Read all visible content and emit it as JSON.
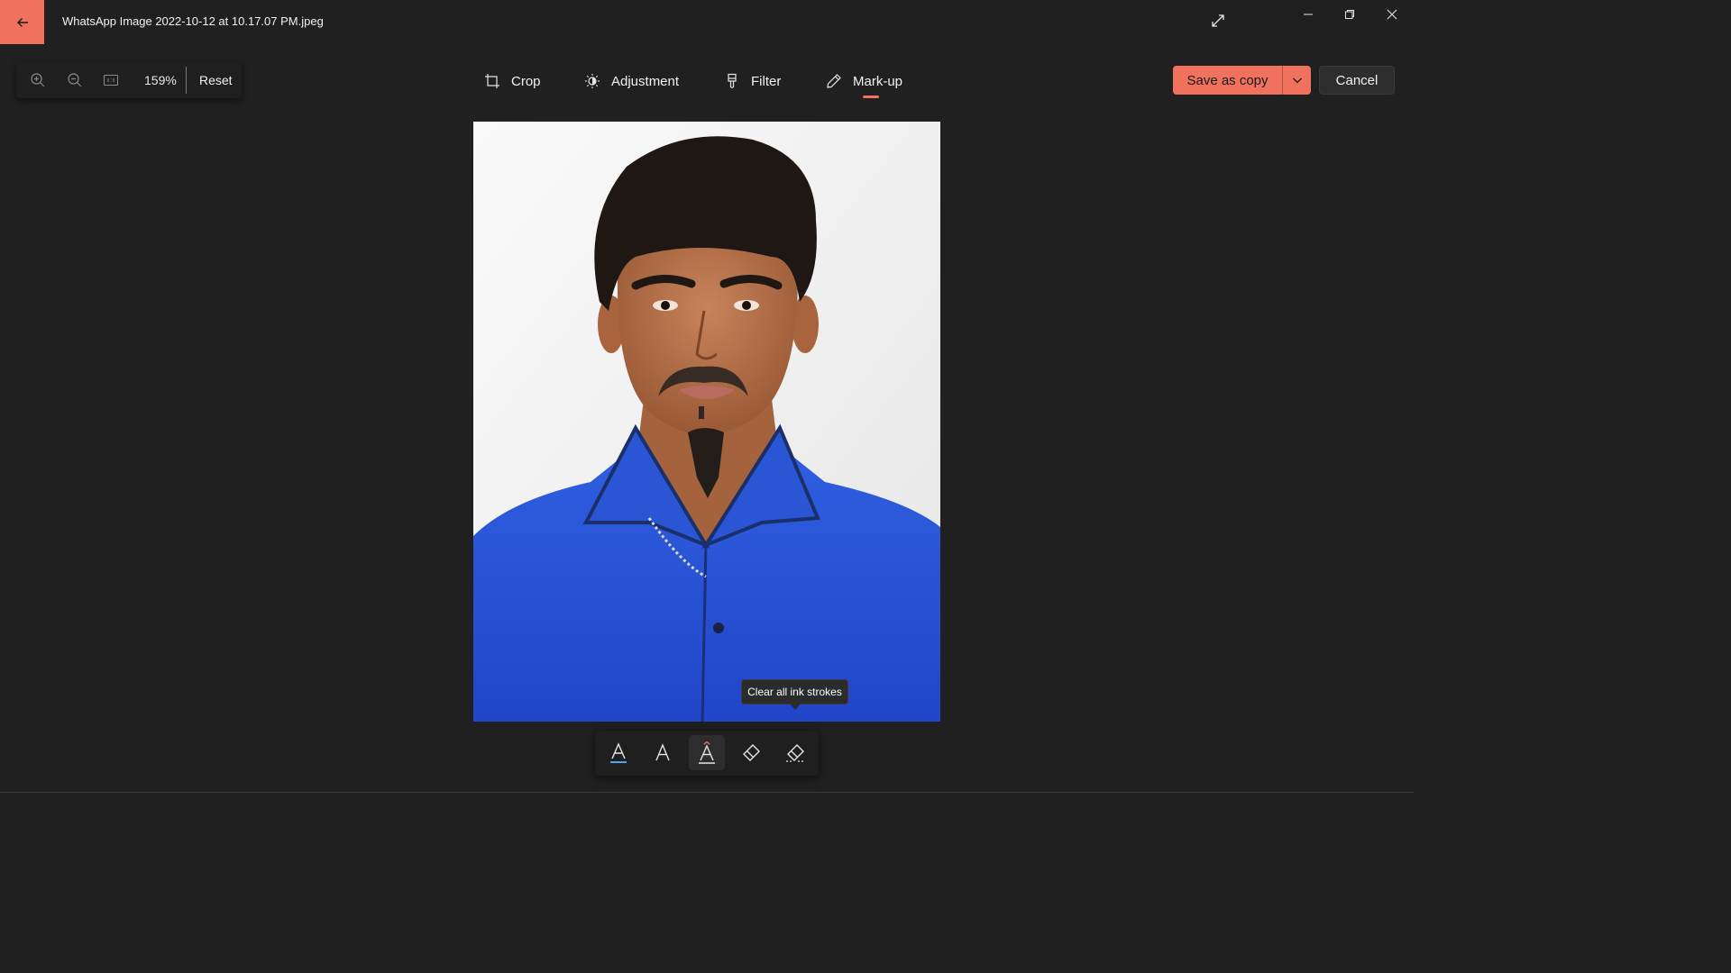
{
  "window": {
    "title": "WhatsApp Image 2022-10-12 at 10.17.07 PM.jpeg",
    "accent_color": "#f0725e"
  },
  "titlebar": {
    "back_icon": "back-arrow-icon",
    "fullscreen_icon": "expand-icon",
    "controls": [
      "minimize-icon",
      "restore-icon",
      "close-icon"
    ]
  },
  "zoom": {
    "zoom_in_icon": "zoom-in-icon",
    "zoom_out_icon": "zoom-out-icon",
    "actual_size_icon": "actual-size-icon",
    "value": "159%",
    "reset_label": "Reset"
  },
  "tools": {
    "crop": "Crop",
    "adjustment": "Adjustment",
    "filter": "Filter",
    "markup": "Mark-up",
    "active": "Mark-up"
  },
  "actions": {
    "save_label": "Save as copy",
    "cancel_label": "Cancel"
  },
  "tooltip": {
    "text": "Clear all ink strokes"
  },
  "ink_toolbar": {
    "tools": [
      "ballpoint-pen-icon",
      "pencil-icon",
      "highlighter-icon",
      "eraser-icon",
      "clear-all-ink-icon"
    ],
    "selected": "highlighter-icon",
    "pen_color": "#4fa3f7",
    "highlighter_mark_color": "#f0725e"
  }
}
